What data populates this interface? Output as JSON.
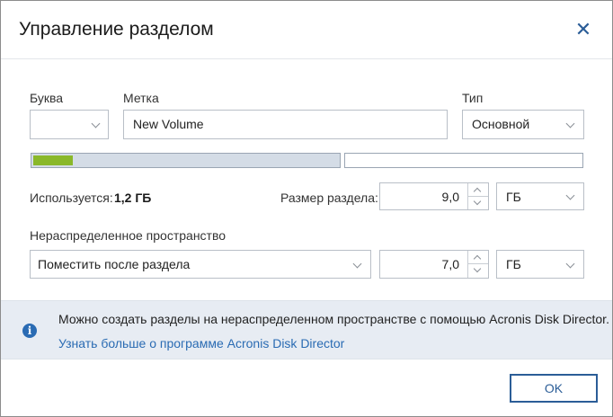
{
  "dialog": {
    "title": "Управление разделом",
    "close_label": "✕"
  },
  "fields": {
    "letter": {
      "label": "Буква",
      "value": ""
    },
    "volume_label": {
      "label": "Метка",
      "value": "New Volume"
    },
    "type": {
      "label": "Тип",
      "value": "Основной"
    }
  },
  "usage": {
    "used_label": "Используется:",
    "used_value": "1,2 ГБ",
    "used_fraction": 0.13
  },
  "size": {
    "label": "Размер раздела:",
    "value": "9,0",
    "unit": "ГБ"
  },
  "unallocated": {
    "label": "Нераспределенное пространство",
    "placement": "Поместить после раздела",
    "value": "7,0",
    "unit": "ГБ"
  },
  "info": {
    "text": "Можно создать разделы на нераспределенном пространстве с помощью Acronis Disk Director.",
    "link": "Узнать больше о программе Acronis Disk Director"
  },
  "footer": {
    "ok_label": "OK"
  },
  "colors": {
    "accent": "#2b5d97",
    "used_bar": "#8ab82a",
    "info_band": "#e7ecf3"
  }
}
